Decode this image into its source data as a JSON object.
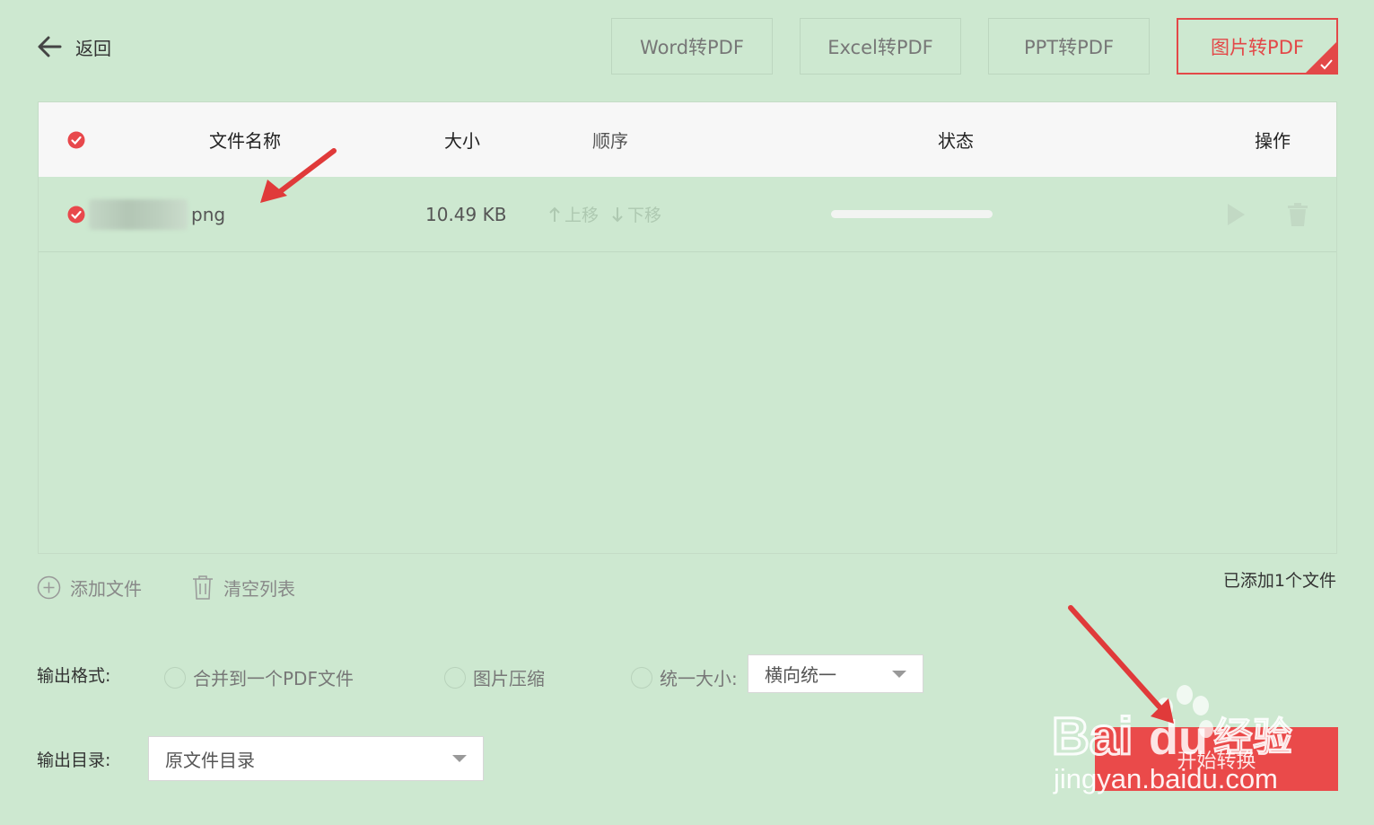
{
  "header": {
    "back_label": "返回",
    "tabs": [
      {
        "label": "Word转PDF",
        "active": false
      },
      {
        "label": "Excel转PDF",
        "active": false
      },
      {
        "label": "PPT转PDF",
        "active": false
      },
      {
        "label": "图片转PDF",
        "active": true
      }
    ]
  },
  "table": {
    "columns": [
      "文件名称",
      "大小",
      "顺序",
      "状态",
      "操作"
    ],
    "rows": [
      {
        "file_ext": "png",
        "size": "10.49 KB",
        "move_up": "上移",
        "move_down": "下移",
        "progress": 0
      }
    ]
  },
  "toolbar": {
    "add_file": "添加文件",
    "clear_list": "清空列表",
    "count_text": "已添加1个文件"
  },
  "options": {
    "format_label": "输出格式:",
    "merge_label": "合并到一个PDF文件",
    "compress_label": "图片压缩",
    "unify_label": "统一大小:",
    "unify_select": "横向统一",
    "dir_label": "输出目录:",
    "dir_select": "原文件目录"
  },
  "start_button": "开始转换",
  "watermark": {
    "brand": "Bai",
    "brand2": "du",
    "cn": "经验",
    "url": "jingyan.baidu.com"
  },
  "colors": {
    "accent": "#e34848",
    "background": "#cde8d0",
    "button": "#ea4a4a"
  },
  "icons": [
    "arrow-left-icon",
    "check-circle-icon",
    "plus-circle-icon",
    "trash-icon",
    "play-icon",
    "chevron-down-icon"
  ]
}
